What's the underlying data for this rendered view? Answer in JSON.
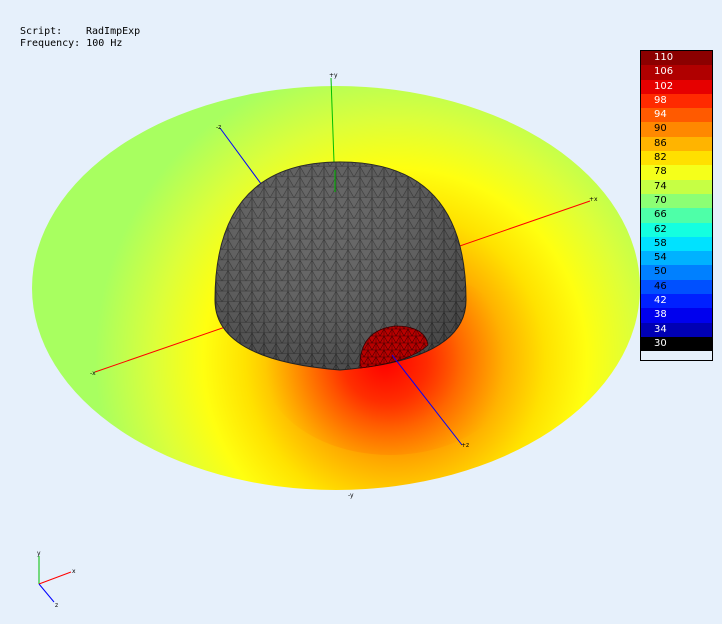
{
  "info": {
    "script_label": "Script:",
    "script_value": "RadImpExp",
    "frequency_label": "Frequency:",
    "frequency_value": "100 Hz"
  },
  "axes": {
    "x": "+x",
    "neg_x": "-x",
    "y": "+y",
    "neg_y": "-y",
    "z": "+z",
    "neg_z": "-z"
  },
  "triad": {
    "y": "y",
    "x": "x",
    "z": "z"
  },
  "legend": {
    "entries": [
      {
        "value": "110",
        "color": "#8b0000",
        "text": "#ffffff"
      },
      {
        "value": "106",
        "color": "#b00000",
        "text": "#ffffff"
      },
      {
        "value": "102",
        "color": "#e60000",
        "text": "#ffffff"
      },
      {
        "value": "98",
        "color": "#ff2a00",
        "text": "#ffffff"
      },
      {
        "value": "94",
        "color": "#ff5a00",
        "text": "#ffffff"
      },
      {
        "value": "90",
        "color": "#ff8800",
        "text": "#000000"
      },
      {
        "value": "86",
        "color": "#ffb400",
        "text": "#000000"
      },
      {
        "value": "82",
        "color": "#ffe000",
        "text": "#000000"
      },
      {
        "value": "78",
        "color": "#f5ff1a",
        "text": "#000000"
      },
      {
        "value": "74",
        "color": "#c6ff44",
        "text": "#000000"
      },
      {
        "value": "70",
        "color": "#8cff74",
        "text": "#000000"
      },
      {
        "value": "66",
        "color": "#4effa8",
        "text": "#000000"
      },
      {
        "value": "62",
        "color": "#14ffe0",
        "text": "#000000"
      },
      {
        "value": "58",
        "color": "#00e2ff",
        "text": "#000000"
      },
      {
        "value": "54",
        "color": "#00b2ff",
        "text": "#000000"
      },
      {
        "value": "50",
        "color": "#0080ff",
        "text": "#000000"
      },
      {
        "value": "46",
        "color": "#0050ff",
        "text": "#000000"
      },
      {
        "value": "42",
        "color": "#0020ff",
        "text": "#ffffff"
      },
      {
        "value": "38",
        "color": "#0000ee",
        "text": "#ffffff"
      },
      {
        "value": "34",
        "color": "#0000b4",
        "text": "#ffffff"
      },
      {
        "value": "30",
        "color": "#000000",
        "text": "#ffffff"
      }
    ]
  }
}
